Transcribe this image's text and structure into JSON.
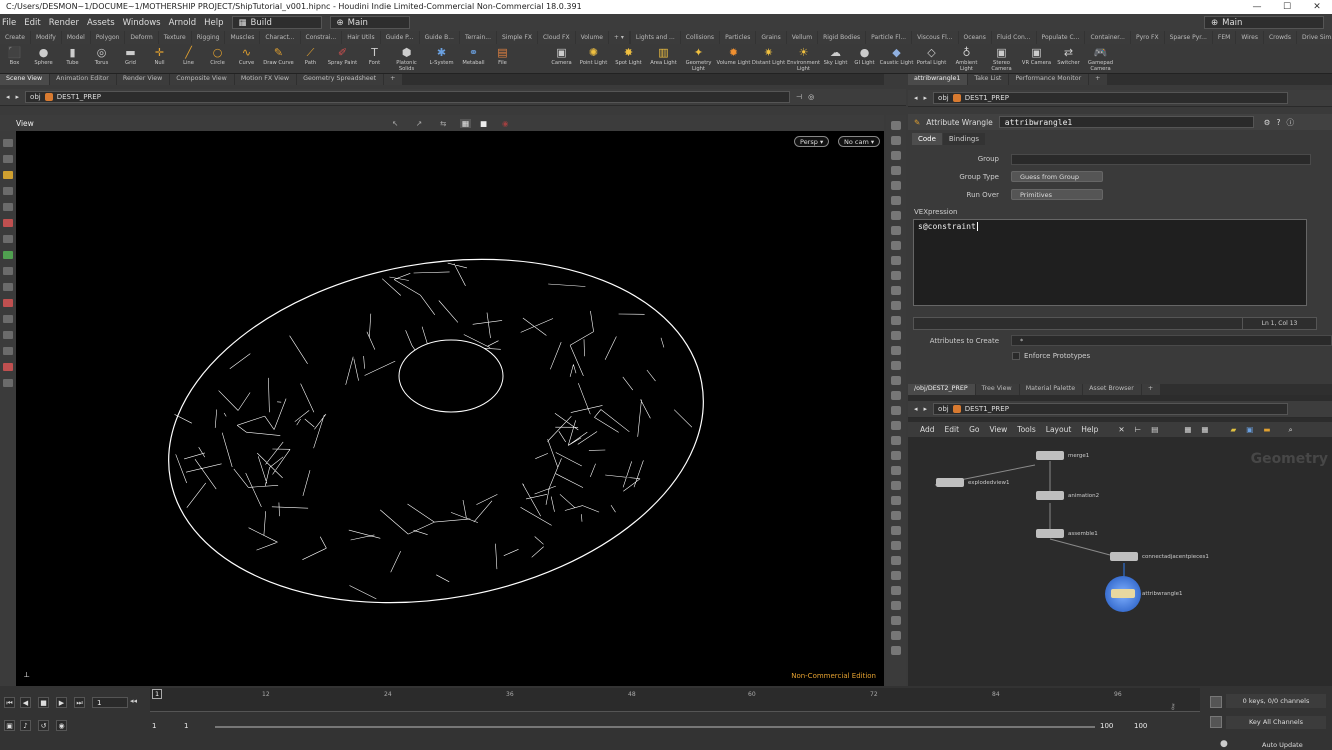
{
  "window": {
    "title": "C:/Users/DESMON~1/DOCUME~1/MOTHERSHIP PROJECT/ShipTutorial_v001.hipnc - Houdini Indie Limited-Commercial Non-Commercial 18.0.391"
  },
  "menubar": {
    "items": [
      "File",
      "Edit",
      "Render",
      "Assets",
      "Windows",
      "Arnold",
      "Help"
    ],
    "desktop": "Build",
    "main_label": "Main",
    "right_desk": "Main"
  },
  "shelf_tabs_left": [
    "Create",
    "Modify",
    "Model",
    "Polygon",
    "Deform",
    "Texture",
    "Rigging",
    "Muscles",
    "Charact...",
    "Constrai...",
    "Hair Utils",
    "Guide P...",
    "Guide B...",
    "Terrain...",
    "Simple FX",
    "Cloud FX",
    "Volume"
  ],
  "shelf_tabs_right": [
    "Lights and ...",
    "Collisions",
    "Particles",
    "Grains",
    "Vellum",
    "Rigid Bodies",
    "Particle Fl...",
    "Viscous Fl...",
    "Oceans",
    "Fluid Con...",
    "Populate C...",
    "Container...",
    "Pyro FX",
    "Sparse Pyr...",
    "FEM",
    "Wires",
    "Crowds",
    "Drive Sim..."
  ],
  "shelf_tools_left": [
    "Box",
    "Sphere",
    "Tube",
    "Torus",
    "Grid",
    "Null",
    "Line",
    "Circle",
    "Curve",
    "Draw Curve",
    "Path",
    "Spray Paint",
    "Font",
    "Platonic Solids",
    "L-System",
    "Metaball",
    "File"
  ],
  "shelf_tools_right": [
    "Camera",
    "Point Light",
    "Spot Light",
    "Area Light",
    "Geometry Light",
    "Volume Light",
    "Distant Light",
    "Environment Light",
    "Sky Light",
    "GI Light",
    "Caustic Light",
    "Portal Light",
    "Ambient Light",
    "Stereo Camera",
    "VR Camera",
    "Switcher",
    "Gamepad Camera"
  ],
  "left_pane_tabs": [
    "Scene View",
    "Animation Editor",
    "Render View",
    "Composite View",
    "Motion FX View",
    "Geometry Spreadsheet"
  ],
  "right_pane_tabs": [
    "attribwrangle1",
    "Take List",
    "Performance Monitor"
  ],
  "path": {
    "obj": "obj",
    "node": "DEST1_PREP"
  },
  "viewport": {
    "label": "View",
    "persp": "Persp ▾",
    "cam": "No cam ▾",
    "watermark": "Non-Commercial Edition"
  },
  "params": {
    "node_type": "Attribute Wrangle",
    "node_name": "attribwrangle1",
    "tabs": [
      "Code",
      "Bindings"
    ],
    "group_label": "Group",
    "group_value": "",
    "group_type_label": "Group Type",
    "group_type_value": "Guess from Group",
    "run_over_label": "Run Over",
    "run_over_value": "Primitives",
    "vex_label": "VEXpression",
    "vex_code": "s@constraint",
    "cursor_pos": "Ln 1, Col 13",
    "attrs_label": "Attributes to Create",
    "attrs_value": "*",
    "enforce_label": "Enforce Prototypes"
  },
  "network_tabs": [
    "/obj/DEST2_PREP",
    "Tree View",
    "Material Palette",
    "Asset Browser"
  ],
  "network_menu": [
    "Add",
    "Edit",
    "Go",
    "View",
    "Tools",
    "Layout",
    "Help"
  ],
  "network_watermark": "Geometry",
  "nodes": [
    {
      "name": "merge1"
    },
    {
      "name": "explodedview1"
    },
    {
      "name": "animation2"
    },
    {
      "name": "assemble1"
    },
    {
      "name": "connectadjacentpieces1"
    },
    {
      "name": "attribwrangle1"
    }
  ],
  "timeline": {
    "frame": "1",
    "ticks": [
      "12",
      "24",
      "36",
      "48",
      "60",
      "72",
      "84",
      "96"
    ],
    "start": "1",
    "start2": "1",
    "end": "100",
    "end2": "100",
    "keys": "0 keys, 0/0 channels",
    "key_all": "Key All Channels",
    "auto_update": "Auto Update"
  }
}
